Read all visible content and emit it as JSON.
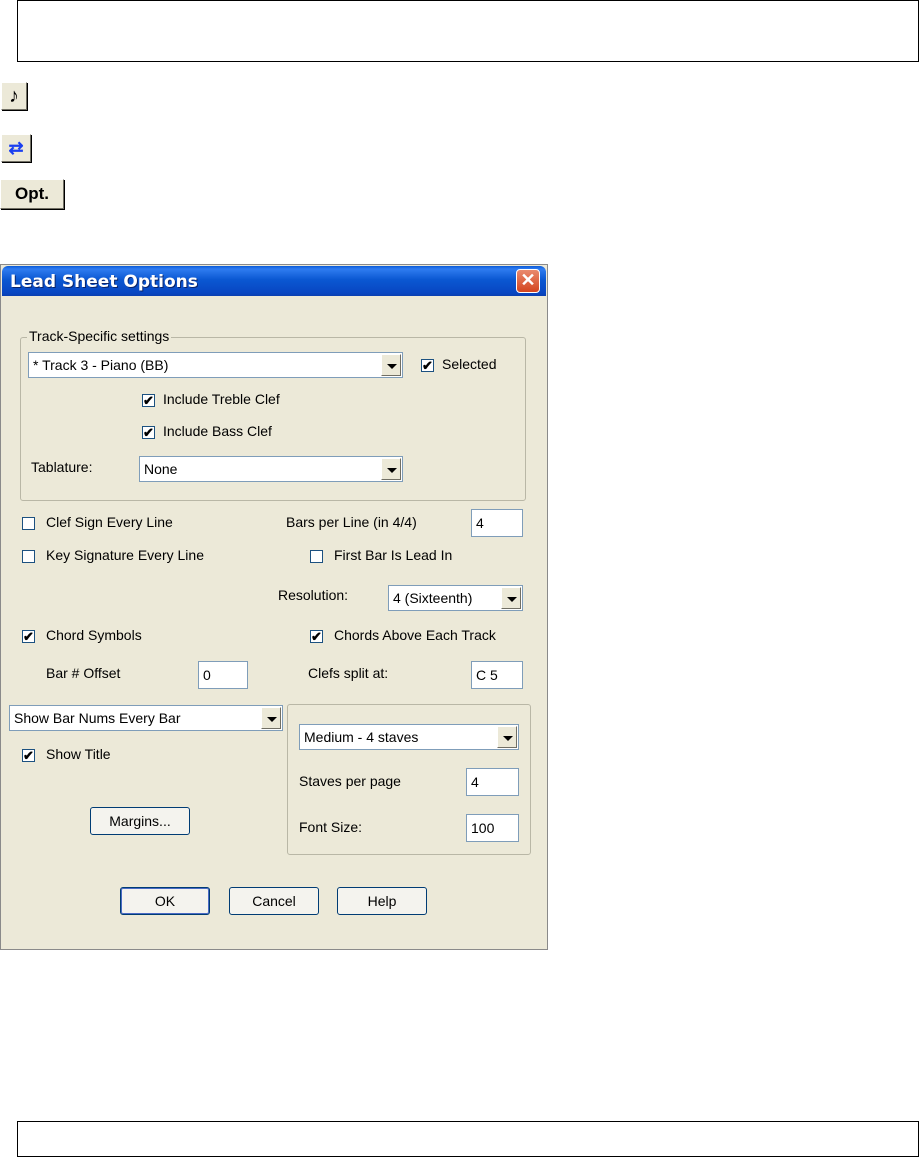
{
  "dialog": {
    "title": "Lead Sheet Options",
    "close_glyph": "✕",
    "track_group": {
      "title": "Track-Specific settings",
      "track_combo_value": "* Track 3 - Piano   (BB)",
      "selected_label": "Selected",
      "selected_checked": true,
      "treble_label": "Include Treble Clef",
      "treble_checked": true,
      "bass_label": "Include Bass Clef",
      "bass_checked": true,
      "tablature_label": "Tablature:",
      "tablature_value": "None"
    },
    "clef_sign_label": "Clef Sign Every Line",
    "clef_sign_checked": false,
    "key_sig_label": "Key Signature Every Line",
    "key_sig_checked": false,
    "bars_per_line_label": "Bars per Line (in 4/4)",
    "bars_per_line_value": "4",
    "first_bar_label": "First Bar Is Lead In",
    "first_bar_checked": false,
    "resolution_label": "Resolution:",
    "resolution_value": "4 (Sixteenth)",
    "chord_symbols_label": "Chord Symbols",
    "chord_symbols_checked": true,
    "chords_above_label": "Chords Above Each Track",
    "chords_above_checked": true,
    "bar_offset_label": "Bar # Offset",
    "bar_offset_value": "0",
    "clefs_split_label": "Clefs split at:",
    "clefs_split_value": "C 5",
    "bar_nums_value": "Show Bar Nums Every Bar",
    "show_title_label": "Show Title",
    "show_title_checked": true,
    "margins_label": "Margins...",
    "staves_combo_value": "Medium - 4 staves",
    "staves_per_page_label": "Staves per page",
    "staves_per_page_value": "4",
    "font_size_label": "Font Size:",
    "font_size_value": "100",
    "ok_label": "OK",
    "cancel_label": "Cancel",
    "help_label": "Help"
  },
  "toolbar_icons": {
    "note_glyph": "♪",
    "loop_glyph": "⇄",
    "opt_label": "Opt."
  },
  "check_glyph": "✔"
}
